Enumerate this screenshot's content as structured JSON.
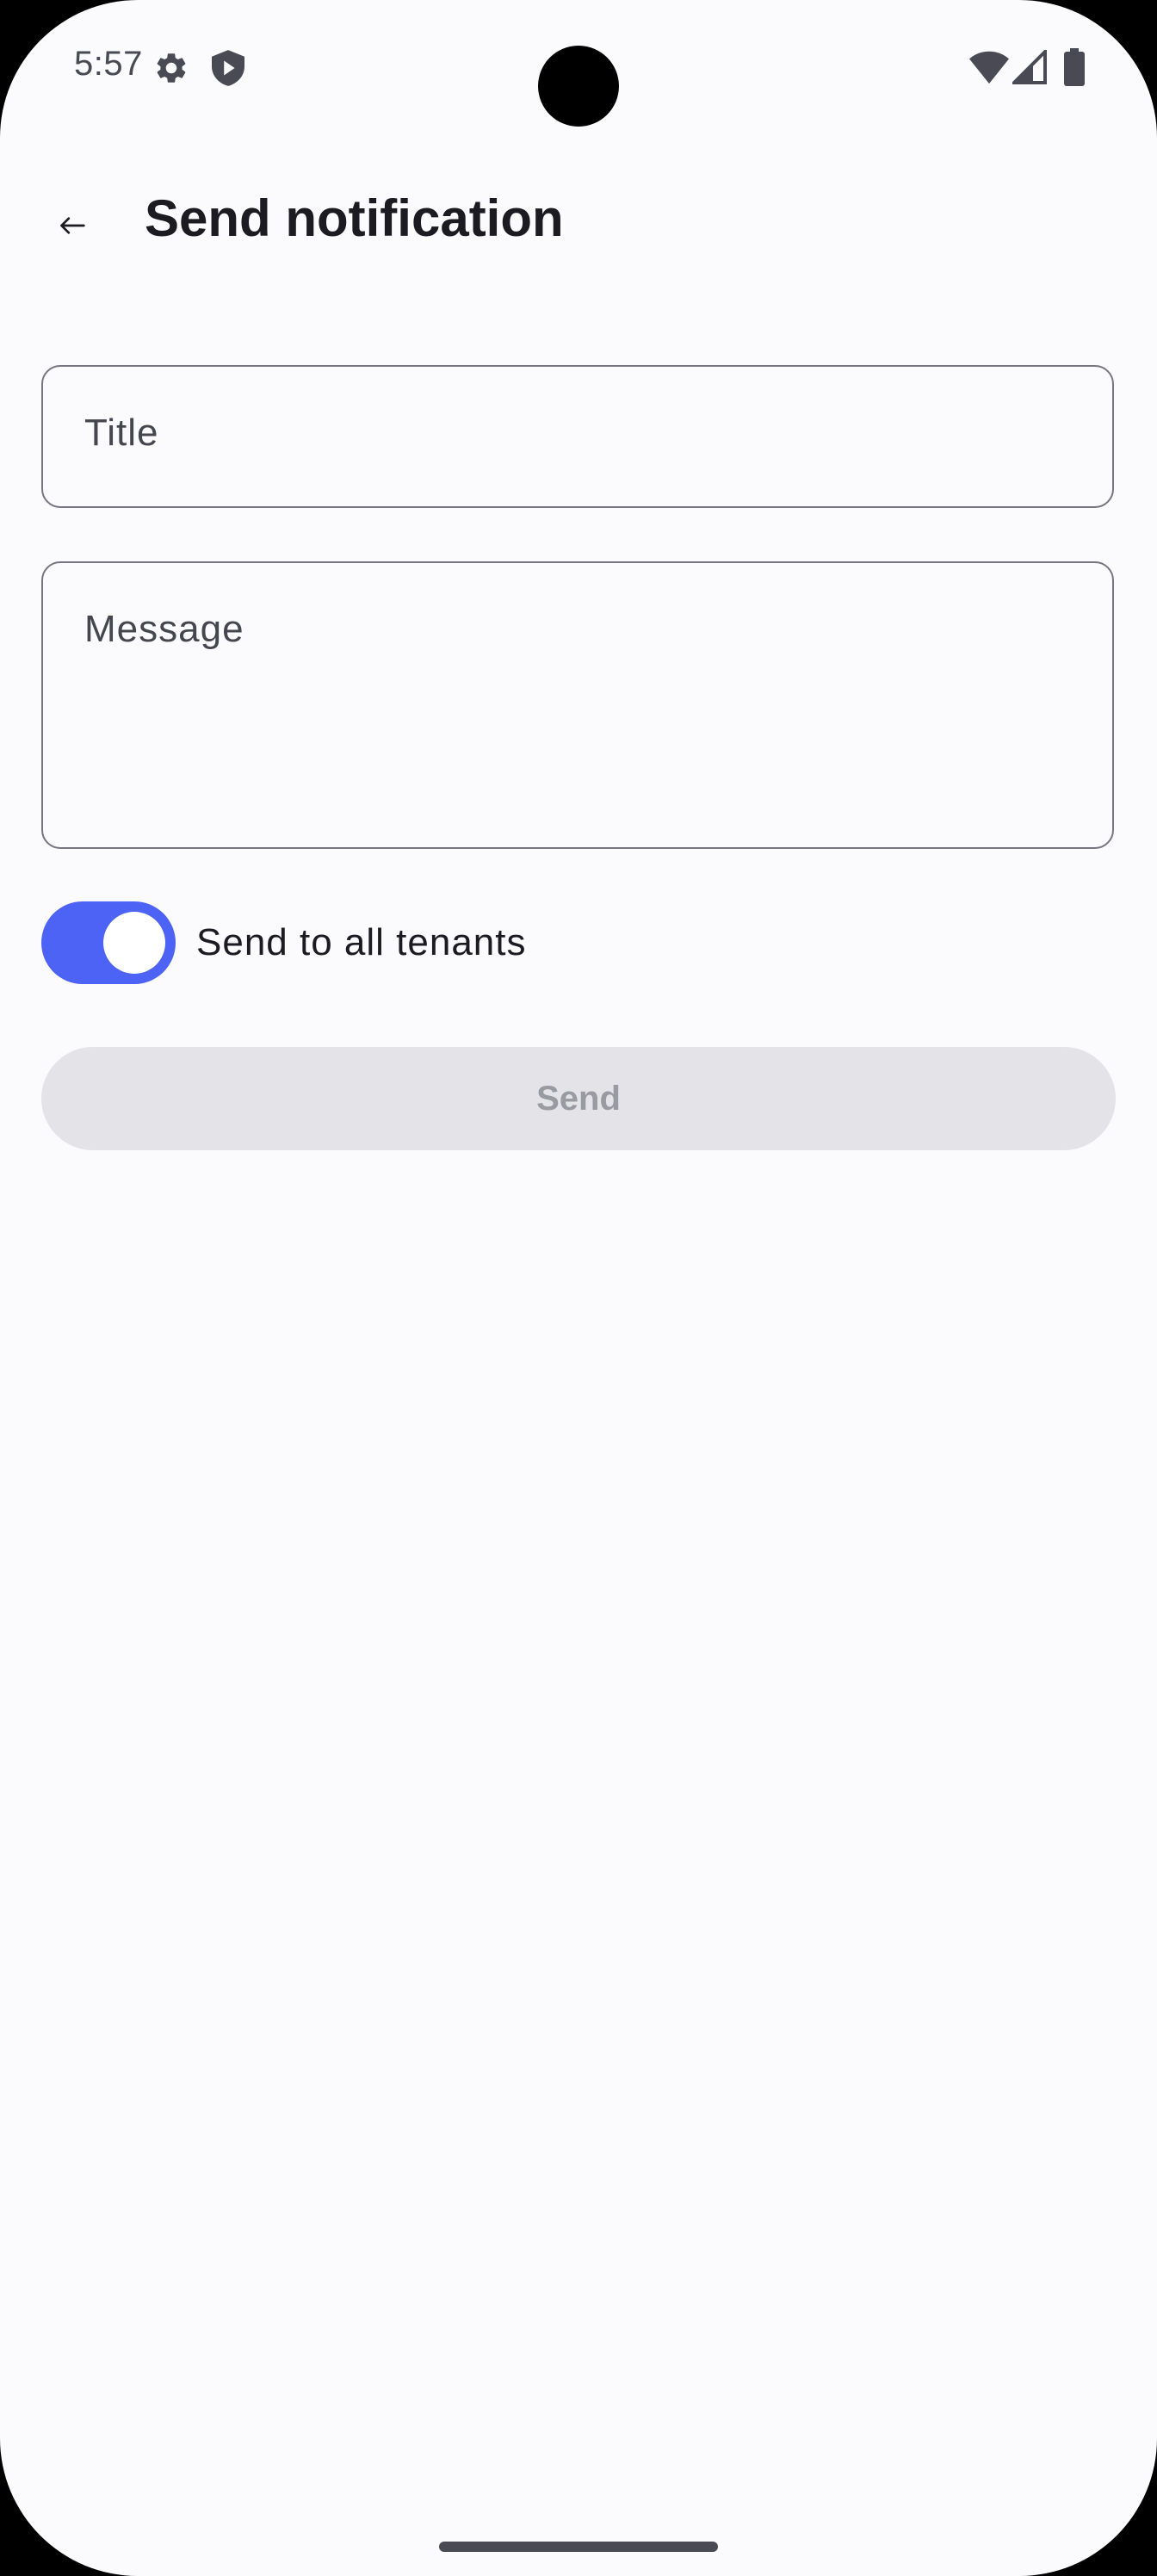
{
  "status_bar": {
    "time": "5:57",
    "icons": [
      "gear-icon",
      "shield-play-icon",
      "wifi-icon",
      "signal-icon",
      "battery-icon"
    ]
  },
  "app_bar": {
    "back_icon": "arrow-left-icon",
    "title": "Send notification"
  },
  "form": {
    "title_field": {
      "label": "Title",
      "value": ""
    },
    "message_field": {
      "label": "Message",
      "value": ""
    },
    "toggle": {
      "label": "Send to all tenants",
      "checked": true
    },
    "send_button": {
      "label": "Send",
      "enabled": false
    }
  },
  "colors": {
    "background": "#fbfbfe",
    "accent": "#4c63f5",
    "outline": "#767680",
    "disabled_button_bg": "#e4e4e8",
    "disabled_button_text": "#9a9aa2"
  }
}
